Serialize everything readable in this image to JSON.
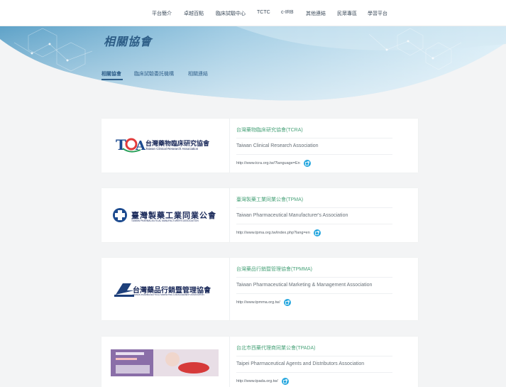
{
  "nav": [
    {
      "label": "平台簡介"
    },
    {
      "label": "卓越百點"
    },
    {
      "label": "臨床試驗中心"
    },
    {
      "label": "TCTC"
    },
    {
      "label": "c-IRB"
    },
    {
      "label": "其他連結"
    },
    {
      "label": "民眾專區"
    },
    {
      "label": "學習平台"
    }
  ],
  "page_title": "相關協會",
  "subnav": [
    {
      "label": "相關協會"
    },
    {
      "label": "臨床試驗委託機構"
    },
    {
      "label": "相關連結"
    }
  ],
  "cards": [
    {
      "name": "台灣藥物臨床研究協會(TCRA)",
      "english": "Taiwan Clinical Research Association",
      "url": "http://www.tcra.org.tw/?language=En",
      "logo_main": "台灣藥物臨床研究協會",
      "logo_sub": "Taiwan Clinical Research Association"
    },
    {
      "name": "臺灣製藥工業同業公會(TPMA)",
      "english": "Taiwan Pharmaceutical Manufacturer's Association",
      "url": "http://www.tpma.org.tw/index.php?lang=en",
      "logo_main": "臺灣製藥工業同業公會",
      "logo_sub": "TAIWAN PHARMACEUTICAL MANUFACTURER'S ASSOCIATION"
    },
    {
      "name": "台灣藥品行銷暨管理協會(TPMMA)",
      "english": "Taiwan Pharmaceutical Marketing & Management Association",
      "url": "http://www.tpmma.org.tw/",
      "logo_main": "台灣藥品行銷暨管理協會",
      "logo_sub": "TAIWAN PHARMACEUTICAL MARKETING & MANAGEMENT ASSOCIATION"
    },
    {
      "name": "台北市西藥代理商同業公會(TPADA)",
      "english": "Taipei Pharmaceutical Agents and Distributors Association",
      "url": "http://www.tpada.org.tw/"
    }
  ],
  "colors": {
    "accent": "#2f5f8a",
    "link_green": "#4aa37a",
    "ext_icon": "#29a8df"
  }
}
